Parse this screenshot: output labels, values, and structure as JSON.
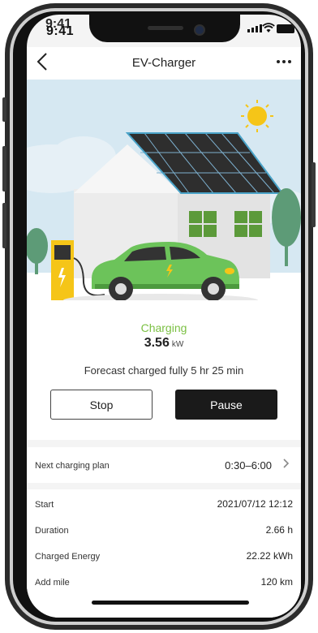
{
  "status_bar": {
    "time": "9:41",
    "time_ghost": "9:41"
  },
  "header": {
    "title": "EV-Charger",
    "back_icon": "chevron-left-icon",
    "more_icon": "more-horizontal-icon"
  },
  "hero": {
    "illustration": "ev-charging-house-illustration"
  },
  "charging": {
    "status_label": "Charging",
    "power_value": "3.56",
    "power_unit": "kW",
    "forecast_text": "Forecast charged fully 5 hr 25 min"
  },
  "actions": {
    "stop_label": "Stop",
    "pause_label": "Pause"
  },
  "plan": {
    "label": "Next charging plan",
    "value": "0:30–6:00"
  },
  "details": [
    {
      "label": "Start",
      "value": "2021/07/12 12:12"
    },
    {
      "label": "Duration",
      "value": "2.66 h"
    },
    {
      "label": "Charged Energy",
      "value": "22.22 kWh"
    },
    {
      "label": "Add mile",
      "value": "120 km"
    }
  ],
  "colors": {
    "accent_green": "#7bc043",
    "car_green": "#6cc35a",
    "sky": "#d6e8f2",
    "charger_yellow": "#f5c518"
  }
}
